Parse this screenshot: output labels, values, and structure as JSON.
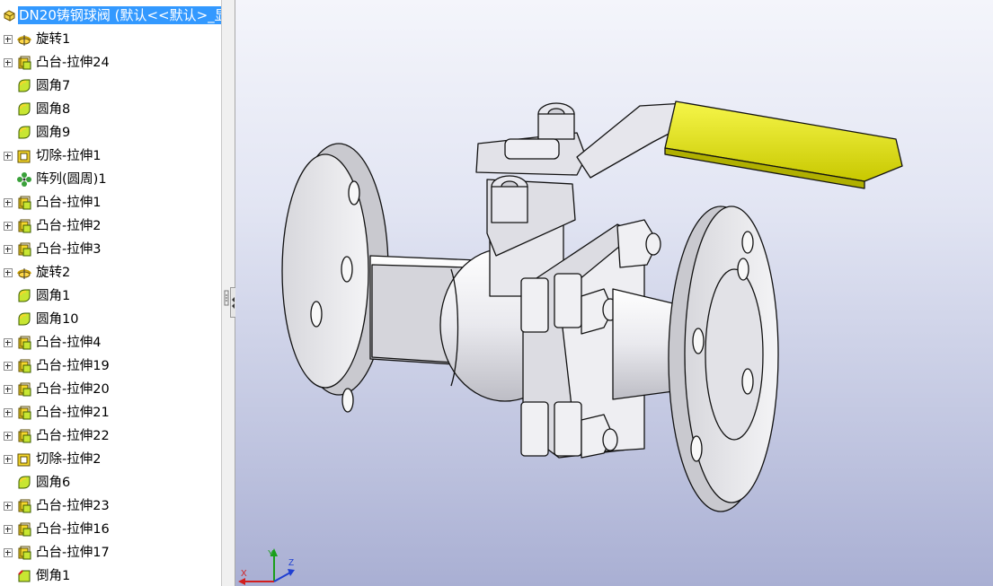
{
  "feature_tree": {
    "root_title": "DN20铸钢球阀 (默认<<默认>_显",
    "items": [
      {
        "label": "旋转1",
        "icon": "revolve-icon",
        "expandable": true
      },
      {
        "label": "凸台-拉伸24",
        "icon": "boss-extrude-icon",
        "expandable": true
      },
      {
        "label": "圆角7",
        "icon": "fillet-icon",
        "expandable": false
      },
      {
        "label": "圆角8",
        "icon": "fillet-icon",
        "expandable": false
      },
      {
        "label": "圆角9",
        "icon": "fillet-icon",
        "expandable": false
      },
      {
        "label": "切除-拉伸1",
        "icon": "cut-extrude-icon",
        "expandable": true
      },
      {
        "label": "阵列(圆周)1",
        "icon": "circular-pattern-icon",
        "expandable": false
      },
      {
        "label": "凸台-拉伸1",
        "icon": "boss-extrude-icon",
        "expandable": true
      },
      {
        "label": "凸台-拉伸2",
        "icon": "boss-extrude-icon",
        "expandable": true
      },
      {
        "label": "凸台-拉伸3",
        "icon": "boss-extrude-icon",
        "expandable": true
      },
      {
        "label": "旋转2",
        "icon": "revolve-icon",
        "expandable": true
      },
      {
        "label": "圆角1",
        "icon": "fillet-icon",
        "expandable": false
      },
      {
        "label": "圆角10",
        "icon": "fillet-icon",
        "expandable": false
      },
      {
        "label": "凸台-拉伸4",
        "icon": "boss-extrude-icon",
        "expandable": true
      },
      {
        "label": "凸台-拉伸19",
        "icon": "boss-extrude-icon",
        "expandable": true
      },
      {
        "label": "凸台-拉伸20",
        "icon": "boss-extrude-icon",
        "expandable": true
      },
      {
        "label": "凸台-拉伸21",
        "icon": "boss-extrude-icon",
        "expandable": true
      },
      {
        "label": "凸台-拉伸22",
        "icon": "boss-extrude-icon",
        "expandable": true
      },
      {
        "label": "切除-拉伸2",
        "icon": "cut-extrude-icon",
        "expandable": true
      },
      {
        "label": "圆角6",
        "icon": "fillet-icon",
        "expandable": false
      },
      {
        "label": "凸台-拉伸23",
        "icon": "boss-extrude-icon",
        "expandable": true
      },
      {
        "label": "凸台-拉伸16",
        "icon": "boss-extrude-icon",
        "expandable": true
      },
      {
        "label": "凸台-拉伸17",
        "icon": "boss-extrude-icon",
        "expandable": true
      },
      {
        "label": "倒角1",
        "icon": "chamfer-icon",
        "expandable": false
      }
    ]
  },
  "triad": {
    "x_label": "X",
    "y_label": "Y",
    "z_label": "Z"
  },
  "colors": {
    "selection": "#3399ff",
    "handle_grip": "#e6e61e",
    "model_body": "#f2f2f2",
    "feature_icon_green": "#c8e632",
    "feature_icon_yellow": "#f5d72d"
  }
}
